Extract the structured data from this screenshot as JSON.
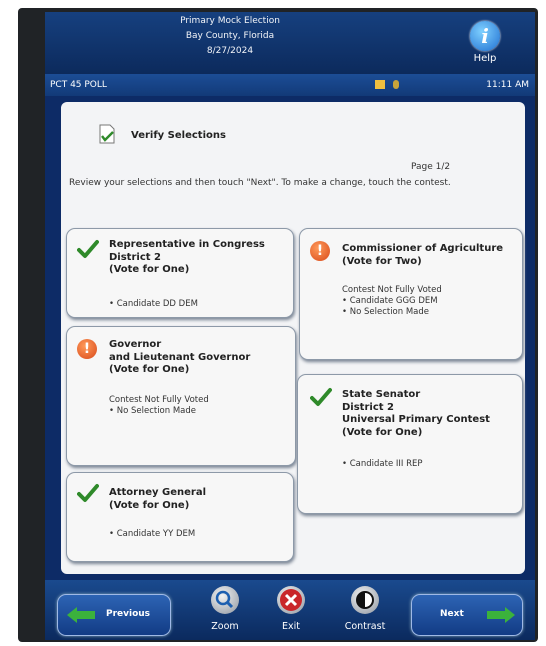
{
  "header": {
    "lines": [
      "Primary Mock Election",
      "Bay County, Florida",
      "8/27/2024"
    ],
    "help_label": "Help",
    "help_glyph": "i"
  },
  "status": {
    "poll": "PCT 45 POLL",
    "time": "11:11 AM"
  },
  "review": {
    "title": "Verify Selections",
    "page": "Page 1/2",
    "instruction": "Review your selections and then touch \"Next\".  To make a change, touch the contest."
  },
  "contests": [
    {
      "status_icon": "checkmark-icon",
      "title": "Representative in Congress\nDistrict 2\n(Vote for One)",
      "lines": [
        "• Candidate DD DEM"
      ]
    },
    {
      "status_icon": "warning-icon",
      "title": "Governor\nand Lieutenant Governor\n(Vote for One)",
      "lines": [
        "Contest Not Fully Voted",
        "• No Selection Made"
      ]
    },
    {
      "status_icon": "checkmark-icon",
      "title": "Attorney General\n(Vote for One)",
      "lines": [
        "• Candidate YY DEM"
      ]
    },
    {
      "status_icon": "warning-icon",
      "title": "Commissioner of Agriculture\n(Vote for Two)",
      "lines": [
        "Contest Not Fully Voted",
        "• Candidate GGG DEM",
        "• No Selection Made"
      ]
    },
    {
      "status_icon": "checkmark-icon",
      "title": "State Senator\nDistrict 2\nUniversal Primary Contest\n(Vote for One)",
      "lines": [
        "• Candidate III REP"
      ]
    }
  ],
  "footer": {
    "previous": "Previous",
    "zoom": "Zoom",
    "exit": "Exit",
    "contrast": "Contrast",
    "next": "Next"
  },
  "colors": {
    "header_blue": "#0d2b66",
    "check_green": "#2f8a2a",
    "warning_orange": "#e0561f",
    "arrow_green": "#3bb23c"
  }
}
